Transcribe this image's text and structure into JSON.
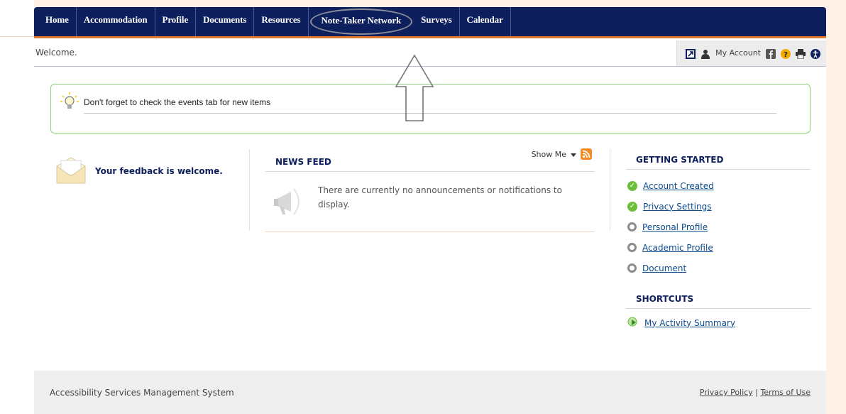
{
  "nav": {
    "items": [
      {
        "label": "Home"
      },
      {
        "label": "Accommodation"
      },
      {
        "label": "Profile"
      },
      {
        "label": "Documents"
      },
      {
        "label": "Resources"
      },
      {
        "label": "Note-Taker Network"
      },
      {
        "label": "Surveys"
      },
      {
        "label": "Calendar"
      }
    ]
  },
  "welcome": {
    "text": "Welcome."
  },
  "account": {
    "label": "My Account"
  },
  "tip": {
    "text": "Don't forget to check the events tab for new items"
  },
  "feedback": {
    "text": "Your feedback is welcome."
  },
  "news": {
    "title": "NEWS FEED",
    "show_me": "Show Me",
    "empty_message": "There are currently no announcements or notifications to display."
  },
  "getting_started": {
    "title": "GETTING STARTED",
    "items": [
      {
        "label": "Account Created",
        "done": true
      },
      {
        "label": "Privacy Settings",
        "done": true
      },
      {
        "label": "Personal Profile",
        "done": false
      },
      {
        "label": "Academic Profile",
        "done": false
      },
      {
        "label": "Document",
        "done": false
      }
    ]
  },
  "shortcuts": {
    "title": "SHORTCUTS",
    "items": [
      {
        "label": "My Activity Summary"
      }
    ]
  },
  "footer": {
    "system_name": "Accessibility Services Management System",
    "privacy": "Privacy Policy",
    "separator": "|",
    "terms": "Terms of Use"
  },
  "colors": {
    "nav_bg": "#0d1f5c",
    "accent": "#e07a2c",
    "tip_border": "#8fd47a",
    "done": "#6bbf3a"
  }
}
